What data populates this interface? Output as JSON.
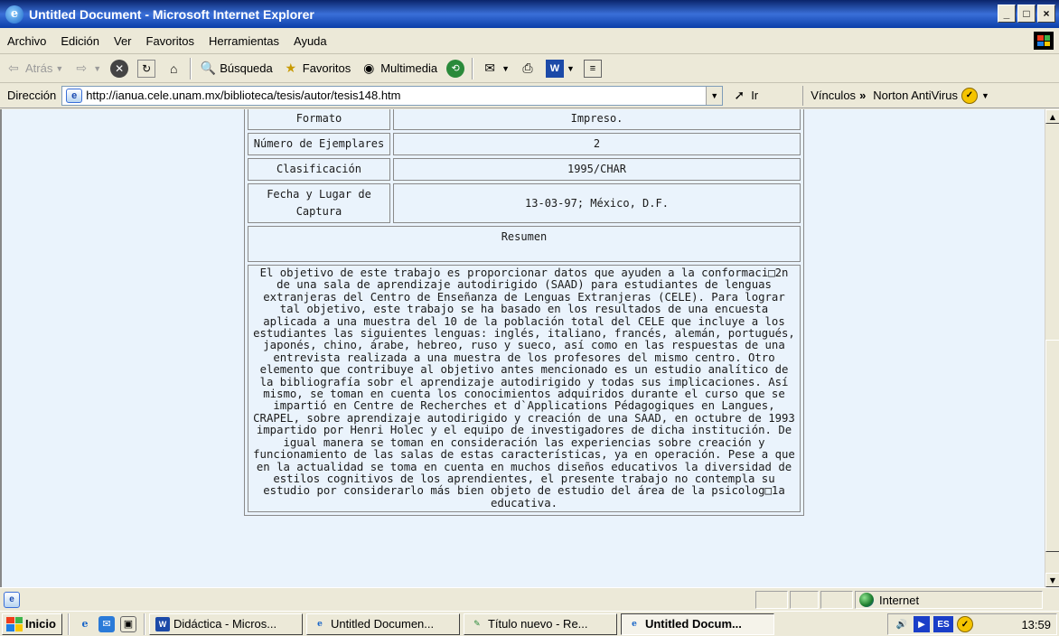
{
  "window": {
    "title": "Untitled Document - Microsoft Internet Explorer",
    "buttons": {
      "minimize": "_",
      "maximize": "□",
      "close": "×"
    }
  },
  "menu": [
    "Archivo",
    "Edición",
    "Ver",
    "Favoritos",
    "Herramientas",
    "Ayuda"
  ],
  "toolbar": {
    "back": "Atrás",
    "search": "Búsqueda",
    "favorites": "Favoritos",
    "media": "Multimedia"
  },
  "address": {
    "label": "Dirección",
    "url": "http://ianua.cele.unam.mx/biblioteca/tesis/autor/tesis148.htm",
    "go": "Ir",
    "links": "Vínculos",
    "links_chevron": "»",
    "norton": "Norton AntiVirus"
  },
  "record": {
    "rows": [
      {
        "label": "Formato",
        "value": "Impreso."
      },
      {
        "label": "Número de Ejemplares",
        "value": "2"
      },
      {
        "label": "Clasificación",
        "value": "1995/CHAR"
      },
      {
        "label": "Fecha y Lugar de Captura",
        "value": "13-03-97; México, D.F."
      }
    ],
    "summary_header": "Resumen",
    "summary": "El objetivo de este trabajo es proporcionar datos que ayuden a la conformaci□2n de una sala de aprendizaje autodirigido (SAAD) para estudiantes de lenguas extranjeras del Centro de Enseñanza de Lenguas Extranjeras (CELE). Para lograr tal objetivo, este trabajo se ha basado en los resultados de una encuesta aplicada a una muestra del 10 de la población total del CELE que incluye a los estudiantes las siguientes lenguas: inglés, italiano, francés, alemán, portugués, japonés, chino, árabe, hebreo, ruso y sueco, así como en las respuestas de una entrevista realizada a una muestra de los profesores del mismo centro. Otro elemento que contribuye al objetivo antes mencionado es un estudio analítico de la bibliografía sobr el aprendizaje autodirigido y todas sus implicaciones. Así mismo, se toman en cuenta los conocimientos adquiridos durante el curso que se impartió en Centre de Recherches et d`Applications Pédagogiques en Langues, CRAPEL, sobre aprendizaje autodirigido y creación de una SAAD, en octubre de 1993 impartido por Henri Holec y el equipo de investigadores de dicha institución. De igual manera se toman en consideración las experiencias sobre creación y funcionamiento de las salas de estas características, ya en operación. Pese a que en la actualidad se toma en cuenta en muchos diseños educativos la diversidad de estilos cognitivos de los aprendientes, el presente trabajo no contempla su estudio por considerarlo más bien objeto de estudio del área de la psicolog□1a educativa."
  },
  "status": {
    "zone": "Internet"
  },
  "taskbar": {
    "start": "Inicio",
    "tasks": [
      "Didáctica - Micros...",
      "Untitled Documen...",
      "Título nuevo - Re...",
      "Untitled Docum..."
    ],
    "active_task": 3,
    "lang": "ES",
    "clock": "13:59"
  }
}
